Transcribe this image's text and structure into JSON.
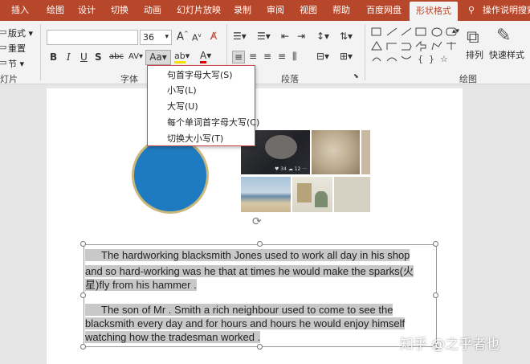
{
  "ribbon_tabs": [
    "插入",
    "绘图",
    "设计",
    "切换",
    "动画",
    "幻灯片放映",
    "录制",
    "审阅",
    "视图",
    "帮助",
    "百度网盘",
    "形状格式"
  ],
  "active_tab": "形状格式",
  "tell_me": "操作说明搜索",
  "slides_group": {
    "layout": "版式",
    "reset": "重置",
    "section": "节",
    "label_partial": "灯片"
  },
  "font": {
    "name": "",
    "size": "36",
    "bold": "B",
    "italic": "I",
    "underline": "U",
    "strike": "S",
    "shadow": "abc",
    "spacing": "AV",
    "case_button": "Aa",
    "grow": "A",
    "shrink": "A",
    "highlight": "ab",
    "color": "A",
    "group_label": "字体"
  },
  "paragraph": {
    "group_label": "段落"
  },
  "drawing": {
    "arrange": "排列",
    "quick_styles": "快速样式",
    "group_label": "绘图"
  },
  "case_menu": {
    "items": [
      "句首字母大写(S)",
      "小写(L)",
      "大写(U)",
      "每个单词首字母大写(C)",
      "切换大小写(T)"
    ]
  },
  "photo_overlay": "♥ 34  ☁ 12  ···",
  "textbox": {
    "line1": "The hardworking blacksmith Jones used to work all day in his shop",
    "line2": "and so hard-working was he that at times he would make the sparks(火",
    "line3": "星)fly from his hammer .",
    "line4": "The son of Mr . Smith a rich neighbour used to come to see the",
    "line5": "blacksmith every day and for hours and hours he would enjoy himself",
    "line6": "watching how the tradesman worked ."
  },
  "watermark": "知乎 @之乎者也",
  "colors": {
    "accent": "#b7472a",
    "circle": "#1f7bc1",
    "menu_border": "#c94b4b"
  }
}
